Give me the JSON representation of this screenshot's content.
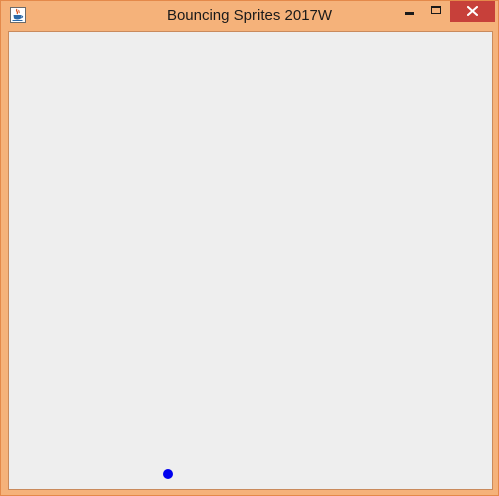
{
  "window": {
    "title": "Bouncing Sprites 2017W",
    "frame_color": "#f5b27a",
    "close_button_color": "#c7403a"
  },
  "icons": {
    "app": "java-cup-icon",
    "minimize": "minimize-icon",
    "maximize": "maximize-icon",
    "close": "close-icon"
  },
  "canvas": {
    "background": "#eeeeee",
    "sprites": [
      {
        "shape": "circle",
        "color": "#0000ee"
      }
    ]
  }
}
